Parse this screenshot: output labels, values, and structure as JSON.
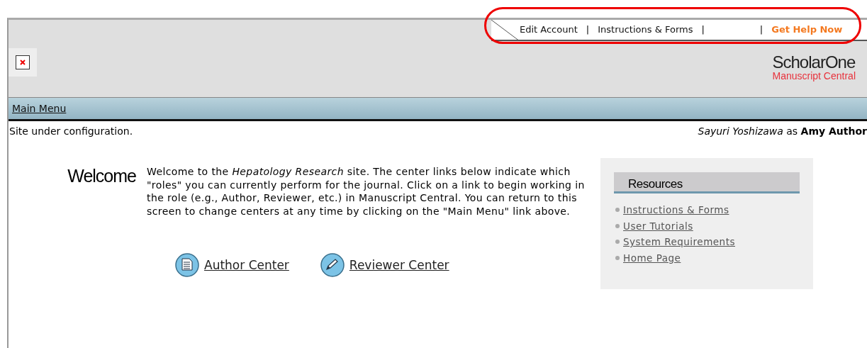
{
  "top_links": [
    {
      "label": "Edit Account",
      "kind": "plain"
    },
    {
      "label": "|",
      "kind": "separator"
    },
    {
      "label": "Instructions & Forms",
      "kind": "plain"
    },
    {
      "label": "|",
      "kind": "separator"
    },
    {
      "label": "|",
      "kind": "separator"
    },
    {
      "label": "Get Help Now",
      "kind": "help"
    }
  ],
  "logo": {
    "name": "ScholarOne",
    "subtitle": "Manuscript Central"
  },
  "nav_bar": {
    "link": "Main Menu"
  },
  "status_message": "Site under configuration.",
  "user": {
    "name": "Sayuri Yoshizawa",
    "connector": "as",
    "role": "Amy Author"
  },
  "welcome": {
    "heading": "Welcome",
    "text": "Welcome to the *Hepatology Research* site. The center links below indicate which \"roles\" you can currently perform for the journal. Click on a link to begin working in the role (e.g., Author, Reviewer, etc.) in Manuscript Central. You can return to this screen to change centers at any time by clicking on the \"Main Menu\" link above."
  },
  "centers": [
    {
      "label": "Author Center",
      "kind": "document"
    },
    {
      "label": "Reviewer Center",
      "kind": "pencil"
    }
  ],
  "resources": {
    "title": "Resources",
    "links": [
      "Instructions & Forms",
      "User Tutorials",
      "System Requirements",
      "Home Page"
    ]
  }
}
